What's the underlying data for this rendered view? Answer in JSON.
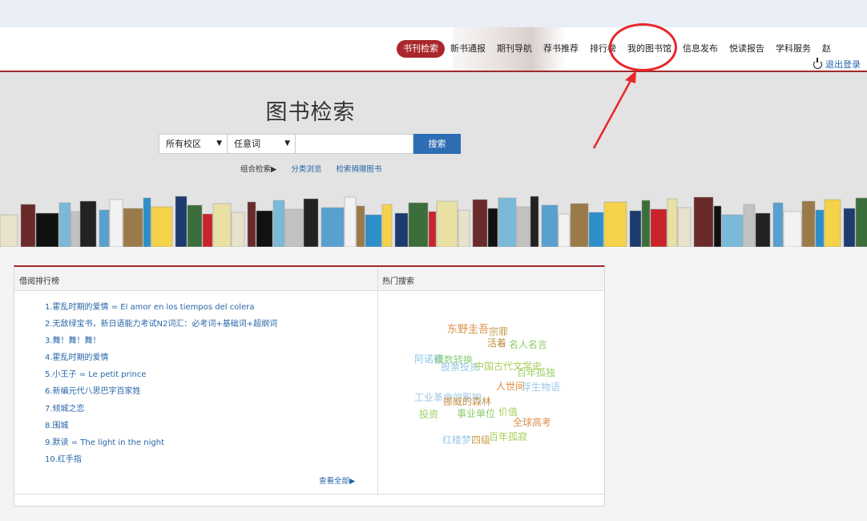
{
  "nav": {
    "items": [
      "书刊检索",
      "新书通报",
      "期刊导航",
      "荐书推荐",
      "排行榜",
      "我的图书馆",
      "信息发布",
      "悦读报告",
      "学科服务"
    ],
    "user_partial": "赵",
    "logout_label": "退出登录"
  },
  "search": {
    "title": "图书检索",
    "campus_select": "所有校区",
    "field_select": "任意词",
    "button_label": "搜索",
    "combo_link": "组合检索",
    "browse_link": "分类浏览",
    "donation_link": "检索捐赠图书"
  },
  "panel": {
    "left_title": "借阅排行榜",
    "right_title": "热门搜索",
    "ranking": [
      "1.霍乱时期的爱情 = El amor en los tiempos del colera",
      "2.无敌绿宝书，新日语能力考试N2词汇：必考词+基础词+超纲词",
      "3.舞！舞！舞！",
      "4.霍乱时期的爱情",
      "5.小王子 = Le petit prince",
      "6.新编元代八思巴字百家姓",
      "7.倾城之恋",
      "8.围城",
      "9.默读 = The light in the night",
      "10.红手指"
    ],
    "view_all": "查看全部",
    "hot_words": [
      "东野圭吾",
      "宗罪",
      "活着",
      "名人名言",
      "阿诺德",
      "模数转换",
      "股票投资",
      "中国古代文学史",
      "百年孤独",
      "人世间",
      "浮生物语",
      "工业革命的影响",
      "挪威的森林",
      "投资",
      "事业单位",
      "价值",
      "全球高考",
      "红楼梦",
      "四级",
      "百年孤寂"
    ]
  },
  "colors": {
    "brand": "#a12a2a",
    "link": "#2866a8",
    "button": "#2f6db5",
    "annotation": "#e8262b"
  }
}
